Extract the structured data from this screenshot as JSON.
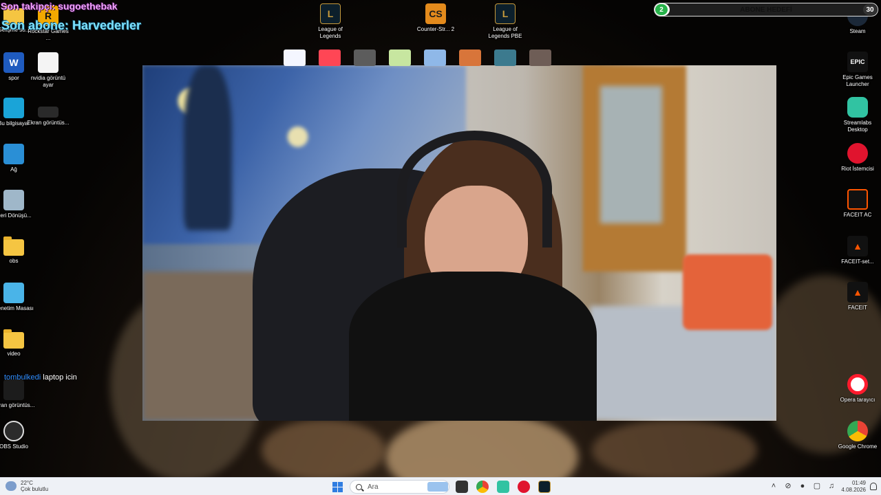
{
  "overlay": {
    "last_follower": "Son takipçi: sugoethebak",
    "last_sub": "Son abone: Harvederler",
    "chat_user": "tombulkedi",
    "chat_message": "laptop icin"
  },
  "sub_goal": {
    "title": "ABONE HEDEFİ",
    "current": "2",
    "target": "30",
    "progress": 0.0667,
    "color": "#27b24a"
  },
  "desktop": {
    "left_col1": [
      {
        "label": "Gelişme so..."
      },
      {
        "label": "spor"
      },
      {
        "label": "Bu bilgisayar"
      },
      {
        "label": "Ağ"
      },
      {
        "label": "Geri Dönüşü..."
      },
      {
        "label": "obs"
      },
      {
        "label": "Denetim Masası"
      },
      {
        "label": "video"
      },
      {
        "label": "Ekran görüntüs..."
      },
      {
        "label": "OBS Studio"
      }
    ],
    "left_col2": [
      {
        "label": "Rockstar Games ..."
      },
      {
        "label": "nvidia görüntü ayar"
      },
      {
        "label": "Ekran görüntüs..."
      }
    ],
    "top": [
      {
        "label": "League of Legends"
      },
      {
        "label": "Counter-Str... 2"
      },
      {
        "label": "League of Legends PBE"
      }
    ],
    "right": [
      {
        "label": "Steam"
      },
      {
        "label": "Epic Games Launcher"
      },
      {
        "label": "Streamlabs Desktop"
      },
      {
        "label": "Riot İstemcisi"
      },
      {
        "label": "FACEIT AC"
      },
      {
        "label": "FACEIT-set..."
      },
      {
        "label": "FACEIT"
      },
      {
        "label": "Opera tarayıcı"
      },
      {
        "label": "Google Chrome"
      }
    ]
  },
  "taskbar": {
    "weather_temp": "22°C",
    "weather_desc": "Çok bulutlu",
    "search_placeholder": "Ara",
    "time": "01:49",
    "date": "4.08.2026"
  }
}
